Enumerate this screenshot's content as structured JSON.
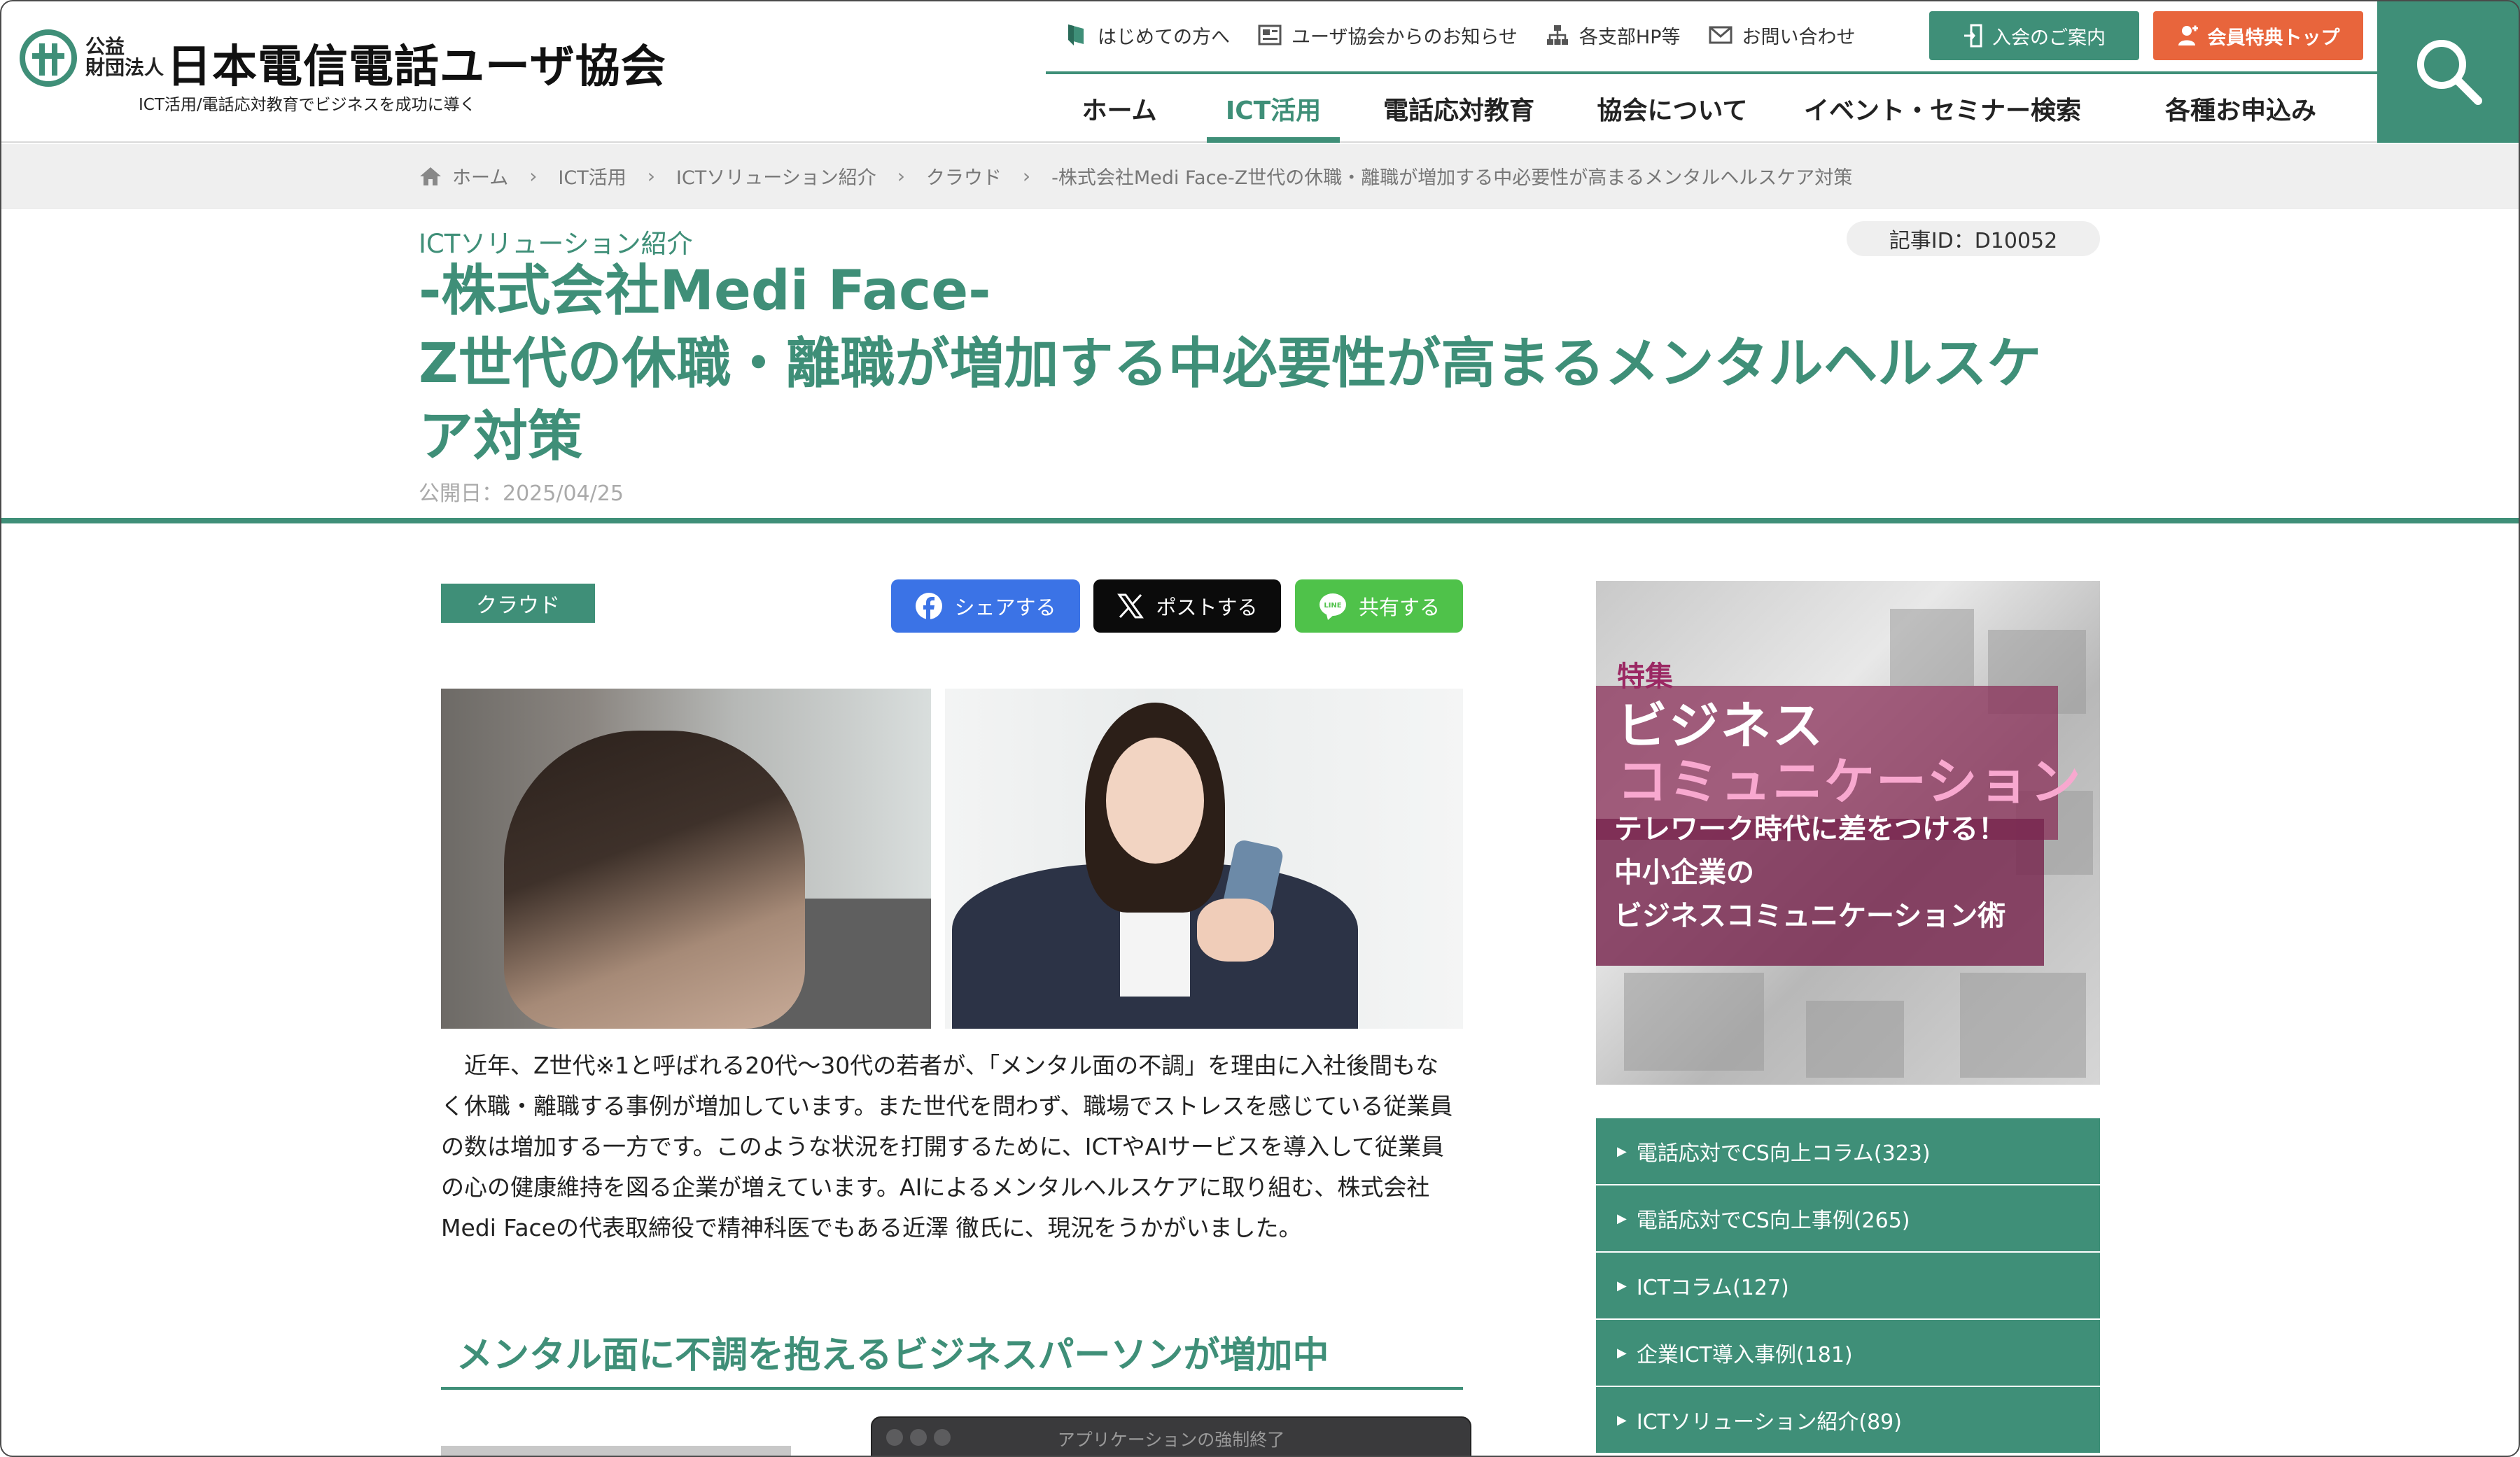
{
  "header": {
    "logo": {
      "small_text": "公益\n財団法人",
      "name": "日本電信電話ユーザ協会",
      "tagline": "ICT活用/電話応対教育でビジネスを成功に導く"
    },
    "util_nav": [
      {
        "label": "はじめての方へ",
        "icon": "leaf-icon"
      },
      {
        "label": "ユーザ協会からのお知らせ",
        "icon": "newspaper-icon"
      },
      {
        "label": "各支部HP等",
        "icon": "org-chart-icon"
      },
      {
        "label": "お問い合わせ",
        "icon": "mail-icon"
      }
    ],
    "join_button": "入会のご案内",
    "member_button": "会員特典トップ",
    "main_nav": [
      {
        "label": "ホーム",
        "active": false
      },
      {
        "label": "ICT活用",
        "active": true
      },
      {
        "label": "電話応対教育",
        "active": false
      },
      {
        "label": "協会について",
        "active": false
      },
      {
        "label": "イベント・セミナー検索",
        "active": false
      },
      {
        "label": "各種お申込み",
        "active": false
      }
    ],
    "search_icon": "search-icon"
  },
  "breadcrumb": [
    "ホーム",
    "ICT活用",
    "ICTソリューション紹介",
    "クラウド",
    "-株式会社Medi Face-Z世代の休職・離職が増加する中必要性が高まるメンタルヘルスケア対策"
  ],
  "article": {
    "category": "ICTソリューション紹介",
    "id_label": "記事ID：D10052",
    "title_lines": [
      "-株式会社Medi Face-",
      "Z世代の休職・離職が増加する中必要性が高まるメンタルヘルスケ",
      "ア対策"
    ],
    "published": "公開日：2025/04/25",
    "tag": "クラウド",
    "share": {
      "facebook": "シェアする",
      "x": "ポストする",
      "line": "共有する"
    },
    "intro_lines": [
      "　近年、Z世代※1と呼ばれる20代〜30代の若者が、「メンタル面の不調」を理由に入社後間もな",
      "く休職・離職する事例が増加しています。また世代を問わず、職場でストレスを感じている従業員",
      "の数は増加する一方です。このような状況を打開するために、ICTやAIサービスを導入して従業員",
      "の心の健康維持を図る企業が増えています。AIによるメンタルヘルスケアに取り組む、株式会社",
      "Medi Faceの代表取締役で精神科医でもある近澤 徹氏に、現況をうかがいました。"
    ],
    "section_heading": "メンタル面に不調を抱えるビジネスパーソンが増加中"
  },
  "sidebar": {
    "banner": {
      "feature": "特集",
      "title1": "ビジネス",
      "title2": "コミュニケーション",
      "sub1": "テレワーク時代に差をつける！",
      "sub2": "中小企業の",
      "sub3": "ビジネスコミュニケーション術"
    },
    "links": [
      "電話応対でCS向上コラム(323)",
      "電話応対でCS向上事例(265)",
      "ICTコラム(127)",
      "企業ICT導入事例(181)",
      "ICTソリューション紹介(89)"
    ]
  },
  "overlay": {
    "force_quit_title": "アプリケーションの強制終了"
  },
  "colors": {
    "brand_green": "#3f8f78",
    "member_orange": "#e8653c",
    "facebook": "#3b73e6",
    "line": "#4fc24a",
    "banner_magenta": "#8a2f58"
  }
}
